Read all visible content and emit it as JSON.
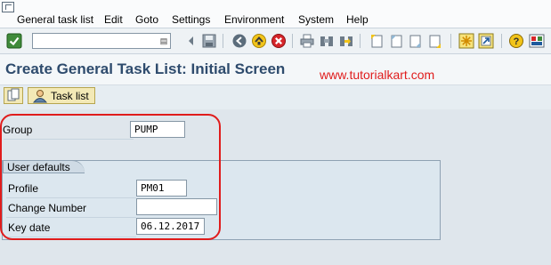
{
  "menubar": {
    "items": [
      {
        "label": "General task list",
        "name": "menu-general-task-list"
      },
      {
        "label": "Edit",
        "name": "menu-edit"
      },
      {
        "label": "Goto",
        "name": "menu-goto"
      },
      {
        "label": "Settings",
        "name": "menu-settings"
      },
      {
        "label": "Environment",
        "name": "menu-environment"
      },
      {
        "label": "System",
        "name": "menu-system"
      },
      {
        "label": "Help",
        "name": "menu-help"
      }
    ]
  },
  "toolbar": {
    "command_field": {
      "value": ""
    },
    "icons": [
      "enter-icon",
      "save-icon",
      "back-icon",
      "exit-icon",
      "cancel-icon",
      "print-icon",
      "find-icon",
      "find-next-icon",
      "first-page-icon",
      "previous-page-icon",
      "next-page-icon",
      "last-page-icon",
      "create-session-icon",
      "shortcut-icon",
      "help-icon",
      "customize-layout-icon"
    ]
  },
  "header": {
    "title": "Create General Task List: Initial Screen",
    "watermark": "www.tutorialkart.com"
  },
  "app_toolbar": {
    "task_list_label": "Task list"
  },
  "form": {
    "group": {
      "label": "Group",
      "value": "PUMP"
    },
    "user_defaults": {
      "title": "User defaults",
      "profile": {
        "label": "Profile",
        "value": "PM01"
      },
      "change_number": {
        "label": "Change Number",
        "value": ""
      },
      "key_date": {
        "label": "Key date",
        "value": "06.12.2017"
      }
    }
  },
  "colors": {
    "title": "#2e4b6d",
    "highlight": "#e01c1c",
    "background": "#dfe6ec",
    "button_yellow": "#f3e9b6"
  }
}
